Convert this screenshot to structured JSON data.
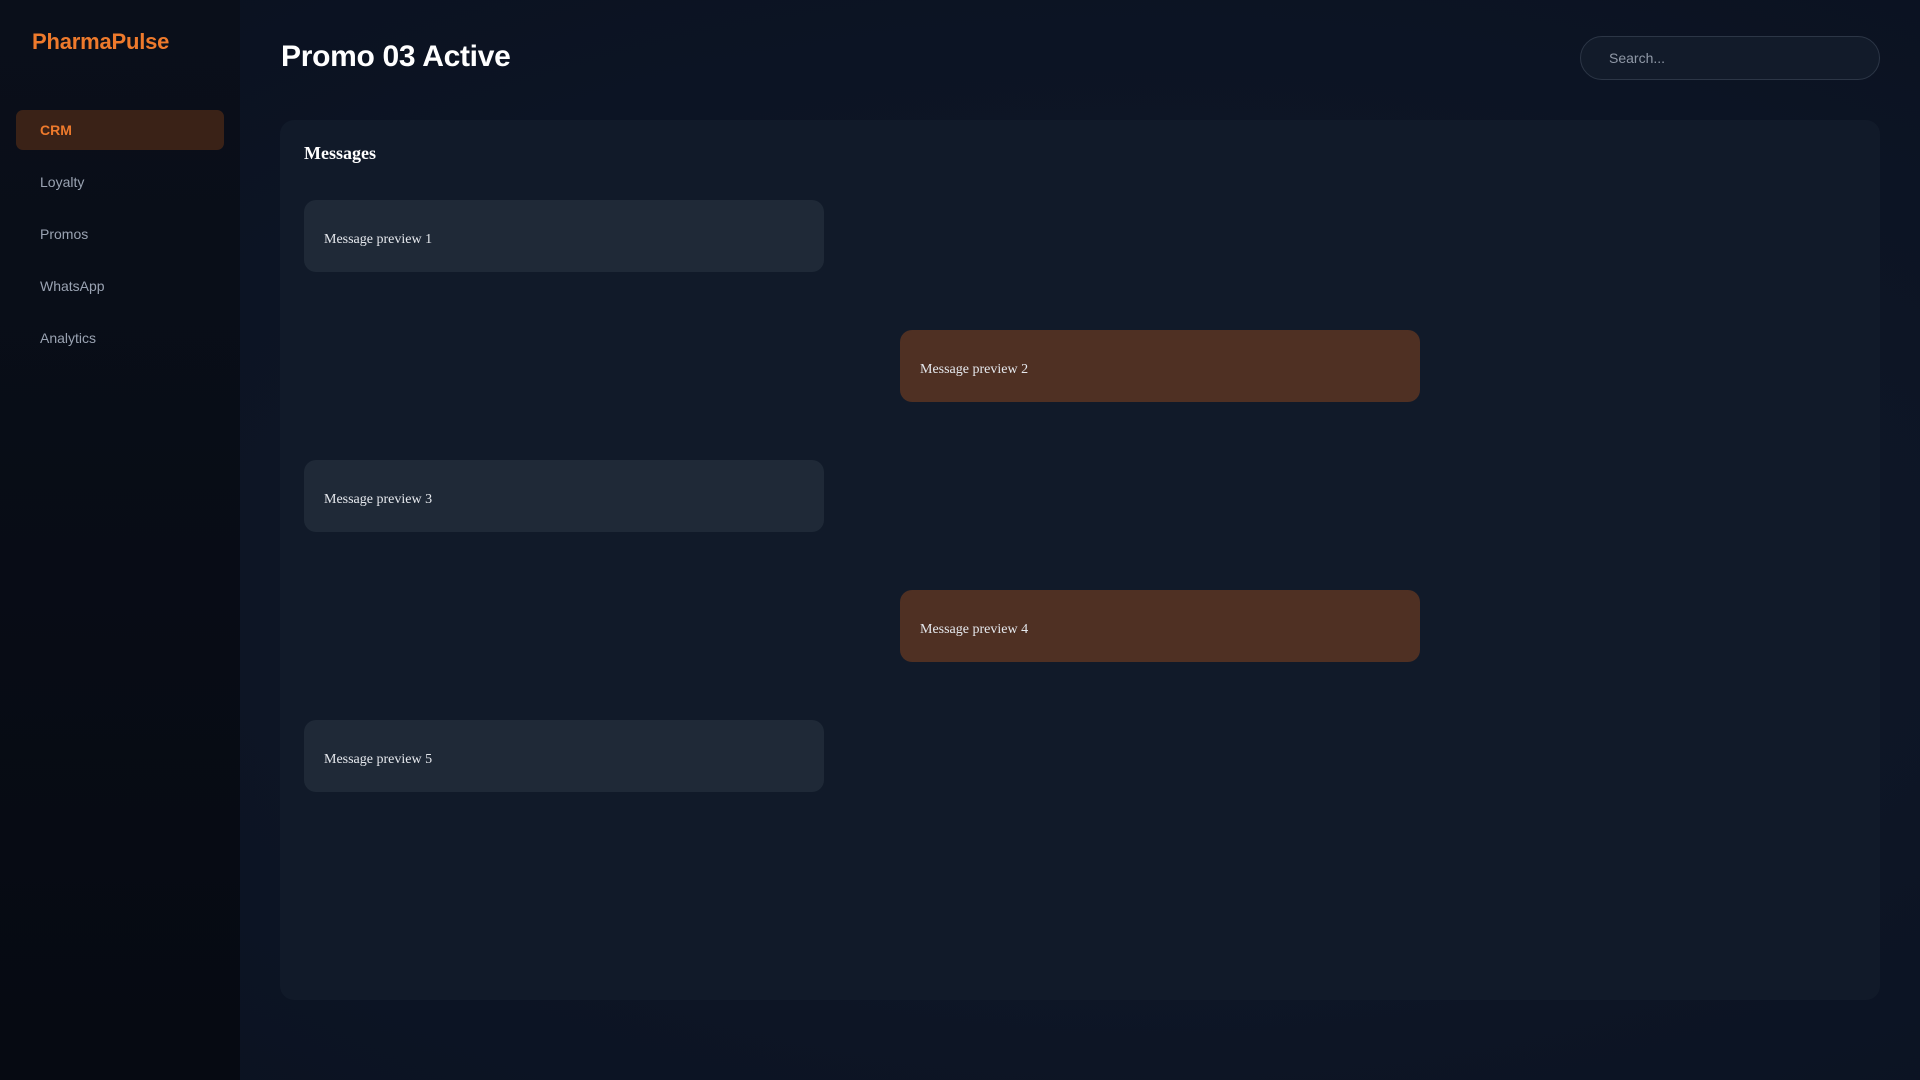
{
  "app": {
    "brand": "PharmaPulse"
  },
  "sidebar": {
    "items": [
      {
        "label": "CRM",
        "active": true
      },
      {
        "label": "Loyalty",
        "active": false
      },
      {
        "label": "Promos",
        "active": false
      },
      {
        "label": "WhatsApp",
        "active": false
      },
      {
        "label": "Analytics",
        "active": false
      }
    ]
  },
  "header": {
    "title": "Promo 03 Active",
    "search_placeholder": "Search..."
  },
  "messages": {
    "title": "Messages",
    "items": [
      {
        "text": "Message preview 1",
        "side": "left"
      },
      {
        "text": "Message preview 2",
        "side": "right"
      },
      {
        "text": "Message preview 3",
        "side": "left"
      },
      {
        "text": "Message preview 4",
        "side": "right"
      },
      {
        "text": "Message preview 5",
        "side": "left"
      }
    ]
  },
  "colors": {
    "accent": "#ee7a2c",
    "active_nav_bg": "#3a2217",
    "incoming_bubble": "#1f2937",
    "outgoing_bubble": "#4f3023",
    "panel_bg": "#111a29",
    "sidebar_bg": "#060a12"
  }
}
